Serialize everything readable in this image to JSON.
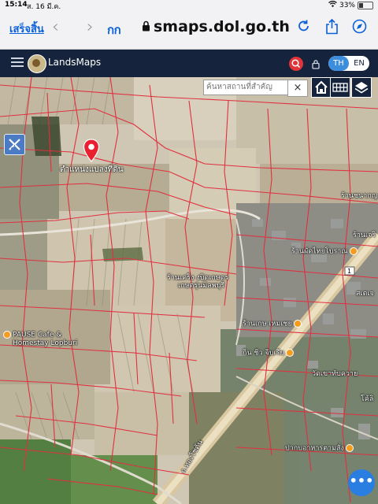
{
  "status": {
    "time": "15:14",
    "date": "ส. 16 มี.ค.",
    "battery": "33%",
    "battery_level": 0.33
  },
  "browser": {
    "done_label": "เสร็จสิ้น",
    "text_size_label": "กก",
    "url": "smaps.dol.go.th"
  },
  "app": {
    "title": "LandsMaps",
    "lang_th": "TH",
    "lang_en": "EN"
  },
  "map": {
    "search_placeholder": "ค้นหาสถานที่สำคัญ",
    "clear_label": "×",
    "pin_label": "ตำแหน่งแปลงที่ดิน",
    "more_label": "•••",
    "pois": [
      {
        "name": "PAUSE Cafe &",
        "name2": "Homestay Lopburi"
      },
      {
        "name": "ร้านชนากญ"
      },
      {
        "name": "ร้านผัดไทยโบราณ"
      },
      {
        "name": "ร้านเคร็ง งบิดเกษตร",
        "name2": "เกษตรุ่นมิลพบุรี"
      },
      {
        "name": "ร้านเกษ เหมเชย"
      },
      {
        "name": "กิน ชิว จิบเรีย"
      },
      {
        "name": "วัดเขาทับควาย"
      },
      {
        "name": "ปากบอาหารตามสั่ง"
      },
      {
        "name": "โค้ลิ"
      },
      {
        "name": "สเตเจ"
      },
      {
        "name": "ร้านเจริ"
      },
      {
        "name": "ถ.ทองโชต้น"
      }
    ]
  },
  "colors": {
    "header": "#15243c",
    "accent": "#2a7de1",
    "parcel": "#e03040",
    "pin": "#e8202f"
  }
}
